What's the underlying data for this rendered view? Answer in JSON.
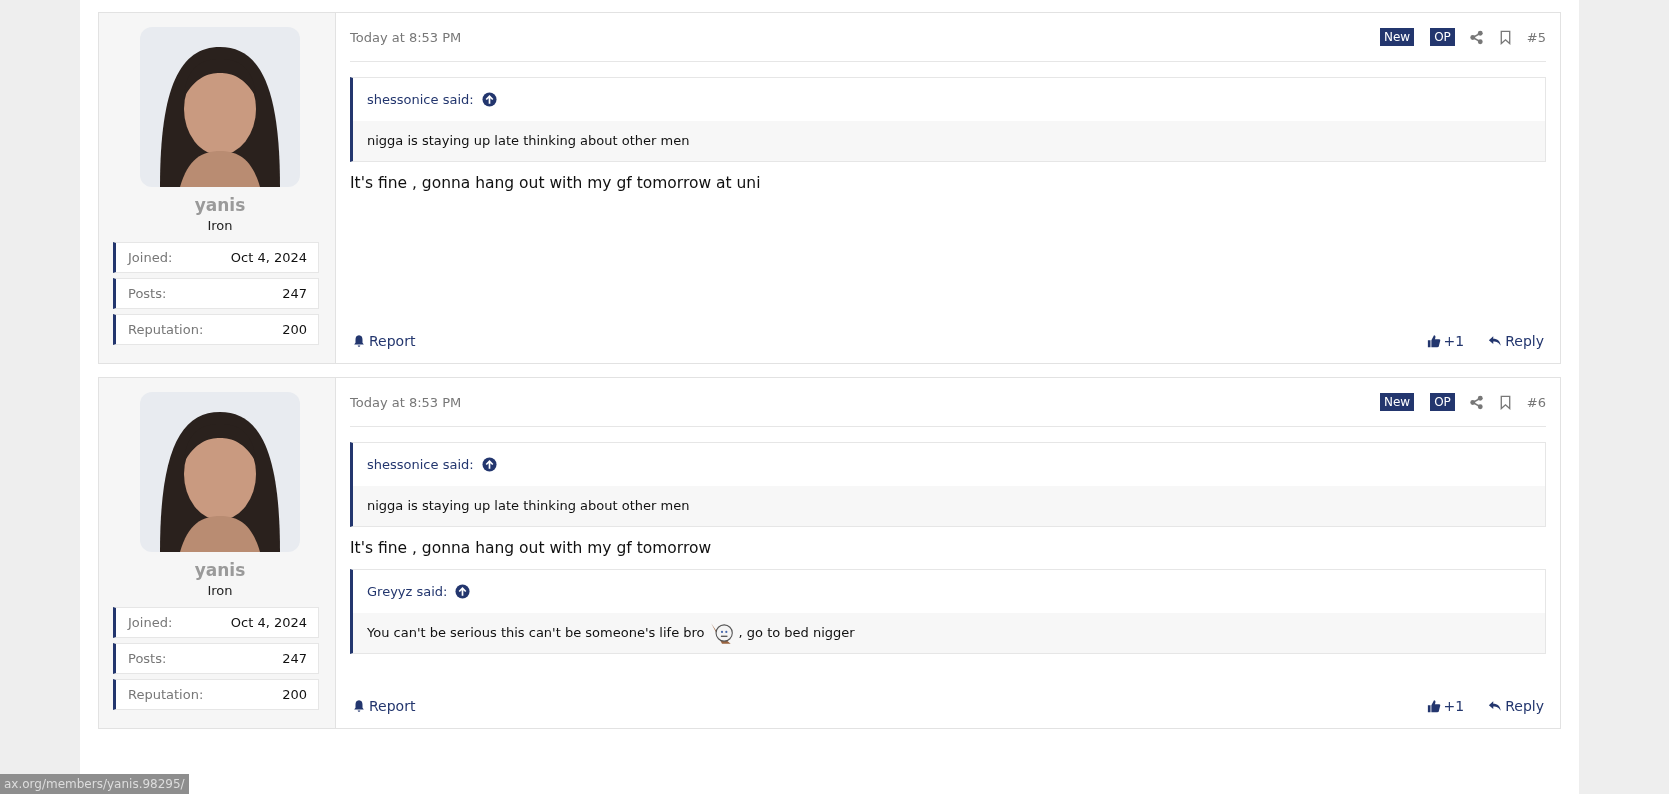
{
  "posts": [
    {
      "author": {
        "name": "yanis",
        "title": "Iron",
        "stats": [
          {
            "label": "Joined:",
            "value": "Oct 4, 2024"
          },
          {
            "label": "Posts:",
            "value": "247"
          },
          {
            "label": "Reputation:",
            "value": "200"
          }
        ]
      },
      "time": "Today at 8:53 PM",
      "badges": [
        "New",
        "OP"
      ],
      "number": "#5",
      "blocks": [
        {
          "kind": "quote",
          "author": "shessonice said:",
          "parts": [
            {
              "kind": "text",
              "text": "nigga is staying up late thinking about other men"
            }
          ]
        },
        {
          "kind": "text",
          "text": "It's fine , gonna hang out with my gf tomorrow at uni"
        }
      ],
      "report": "Report",
      "reaction": "+1",
      "reply": "Reply"
    },
    {
      "author": {
        "name": "yanis",
        "title": "Iron",
        "stats": [
          {
            "label": "Joined:",
            "value": "Oct 4, 2024"
          },
          {
            "label": "Posts:",
            "value": "247"
          },
          {
            "label": "Reputation:",
            "value": "200"
          }
        ]
      },
      "time": "Today at 8:53 PM",
      "badges": [
        "New",
        "OP"
      ],
      "number": "#6",
      "blocks": [
        {
          "kind": "quote",
          "author": "shessonice said:",
          "parts": [
            {
              "kind": "text",
              "text": "nigga is staying up late thinking about other men"
            }
          ]
        },
        {
          "kind": "text",
          "text": "It's fine , gonna hang out with my gf tomorrow"
        },
        {
          "kind": "quote",
          "author": "Greyyz said:",
          "parts": [
            {
              "kind": "text",
              "text": "You can't be serious this can't be someone's life bro"
            },
            {
              "kind": "smilie"
            },
            {
              "kind": "text",
              "text": ", go to bed nigger"
            }
          ]
        }
      ],
      "report": "Report",
      "reaction": "+1",
      "reply": "Reply"
    }
  ],
  "status_url": "ax.org/members/yanis.98295/"
}
